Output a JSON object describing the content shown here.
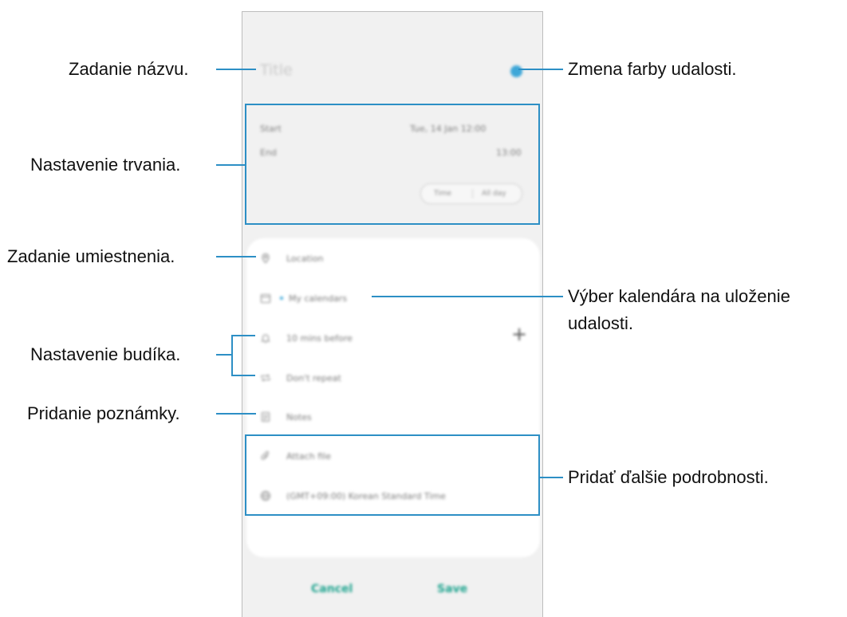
{
  "phone": {
    "title_placeholder": "Title",
    "start_label": "Start",
    "start_value": "Tue, 14 Jan   12:00",
    "end_label": "End",
    "end_value": "13:00",
    "time_option": "Time",
    "allday_option": "All day",
    "location": "Location",
    "calendar": "My calendars",
    "reminder": "10 mins before",
    "repeat": "Don't repeat",
    "notes": "Notes",
    "attach": "Attach file",
    "timezone": "(GMT+09:00) Korean Standard Time",
    "cancel": "Cancel",
    "save": "Save",
    "event_color": "#3ea7d8"
  },
  "callouts": {
    "title": "Zadanie názvu.",
    "color": "Zmena farby udalosti.",
    "duration": "Nastavenie trvania.",
    "location": "Zadanie umiestnenia.",
    "calendar_line1": "Výber kalendára na uloženie",
    "calendar_line2": "udalosti.",
    "alarm": "Nastavenie budíka.",
    "note": "Pridanie poznámky.",
    "details": "Pridať ďalšie podrobnosti."
  },
  "accent_color": "#2d8fc5"
}
